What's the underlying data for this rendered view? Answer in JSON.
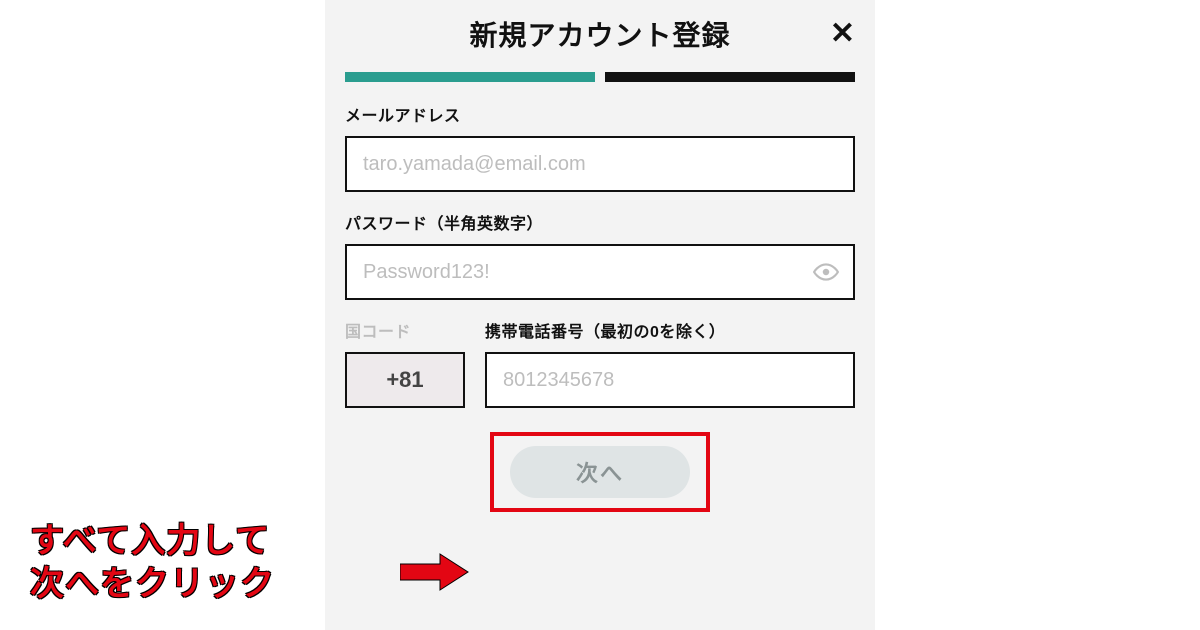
{
  "header": {
    "title": "新規アカウント登録",
    "close_symbol": "✕"
  },
  "progress": {
    "steps": 2,
    "current": 1
  },
  "form": {
    "email": {
      "label": "メールアドレス",
      "placeholder": "taro.yamada@email.com",
      "value": ""
    },
    "password": {
      "label": "パスワード（半角英数字）",
      "placeholder": "Password123!",
      "value": ""
    },
    "country_code": {
      "label": "国コード",
      "value": "+81"
    },
    "phone": {
      "label": "携帯電話番号（最初の0を除く）",
      "placeholder": "8012345678",
      "value": ""
    },
    "next_label": "次へ"
  },
  "annotation": {
    "text": "すべて入力して\n次へをクリック"
  },
  "colors": {
    "accent": "#2a9d8f",
    "annotation_red": "#e30613"
  }
}
